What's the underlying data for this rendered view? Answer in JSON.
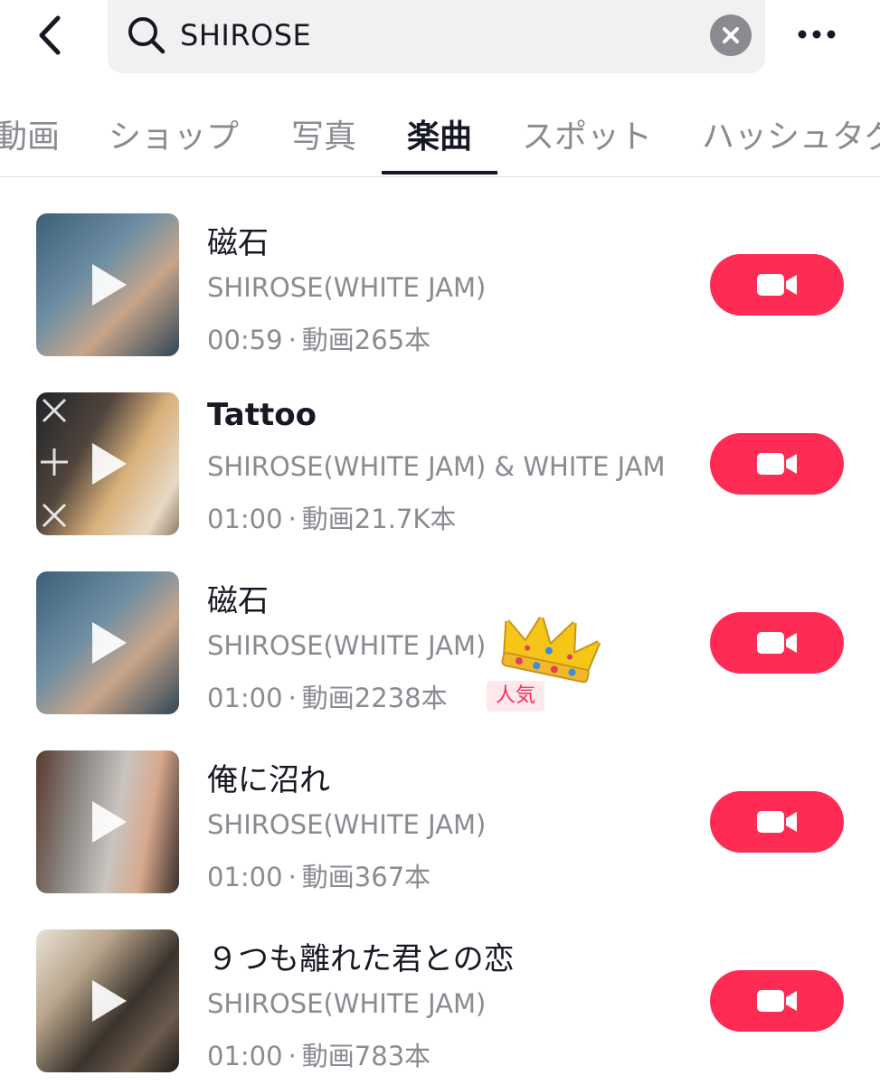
{
  "header": {
    "back_icon": "chevron-left-icon",
    "search_icon": "search-icon",
    "search_value": "SHIROSE",
    "clear_icon": "close-circle-icon",
    "more_icon": "more-dots-icon"
  },
  "tabs": [
    {
      "label": "動画"
    },
    {
      "label": "ショップ"
    },
    {
      "label": "写真"
    },
    {
      "label": "楽曲",
      "active": true
    },
    {
      "label": "スポット"
    },
    {
      "label": "ハッシュタグ"
    }
  ],
  "songs": [
    {
      "title": "磁石",
      "artist": "SHIROSE(WHITE JAM)",
      "duration": "00:59",
      "videos": "動画265本"
    },
    {
      "title": "Tattoo",
      "artist": "SHIROSE(WHITE JAM) & WHITE JAM",
      "duration": "01:00",
      "videos": "動画21.7K本"
    },
    {
      "title": "磁石",
      "artist": "SHIROSE(WHITE JAM)",
      "duration": "01:00",
      "videos": "動画2238本",
      "badge": "人気"
    },
    {
      "title": "俺に沼れ",
      "artist": "SHIROSE(WHITE JAM)",
      "duration": "01:00",
      "videos": "動画367本"
    },
    {
      "title": "９つも離れた君との恋",
      "artist": "SHIROSE(WHITE JAM)",
      "duration": "01:00",
      "videos": "動画783本"
    }
  ],
  "separator": "·",
  "colors": {
    "accent": "#fe2c55",
    "text_primary": "#161823",
    "text_secondary": "#8a8b91",
    "search_bg": "#f1f1f2",
    "badge_bg": "#fde8ec"
  },
  "icons": {
    "play": "play-icon",
    "use_sound": "video-camera-icon",
    "sticker": "crown-icon"
  }
}
